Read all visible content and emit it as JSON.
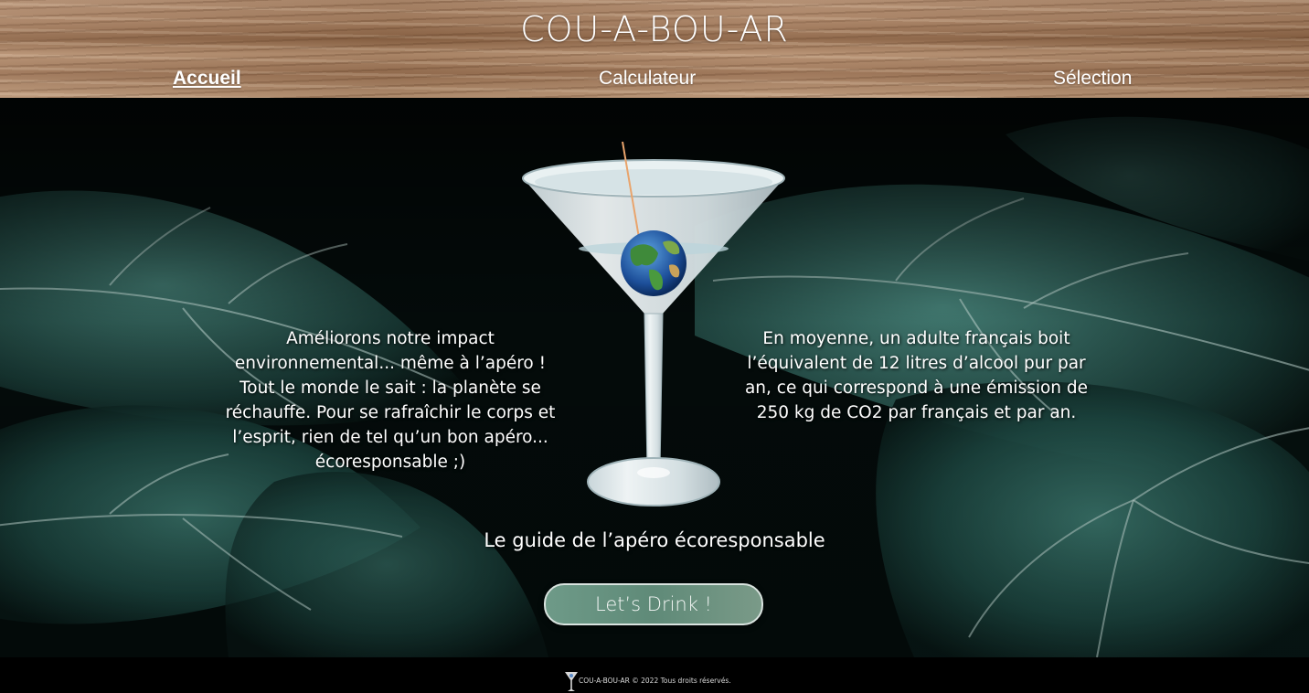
{
  "header": {
    "site_title": "COU-A-BOU-AR",
    "nav": [
      {
        "label": "Accueil",
        "active": true
      },
      {
        "label": "Calculateur",
        "active": false
      },
      {
        "label": "Sélection",
        "active": false
      }
    ]
  },
  "hero": {
    "left_text": "Améliorons notre impact\nenvironnemental... même à l’apéro !\nTout le monde le sait : la planète se\nréchauffe. Pour se rafraîchir le corps et\nl’esprit, rien de tel qu’un bon apéro...\nécoresponsable ;)",
    "right_text": "En moyenne, un adulte français boit\nl’équivalent de 12 litres d’alcool pur par\nan, ce qui correspond à une émission de\n250 kg de CO2 par français et par an.",
    "guide_text": "Le guide de l’apéro écoresponsable",
    "cta_label": "Let’s Drink !",
    "image_icon": "martini-glass-with-earth-icon"
  },
  "footer": {
    "logo_icon": "martini-glass-icon",
    "text": "COU-A-BOU-AR © 2022 Tous droits réservés."
  },
  "colors": {
    "background": "#000000",
    "button": "#6e9a88",
    "text": "#ffffff",
    "wood": "#a77f60",
    "leaves": "#2f6b62"
  }
}
